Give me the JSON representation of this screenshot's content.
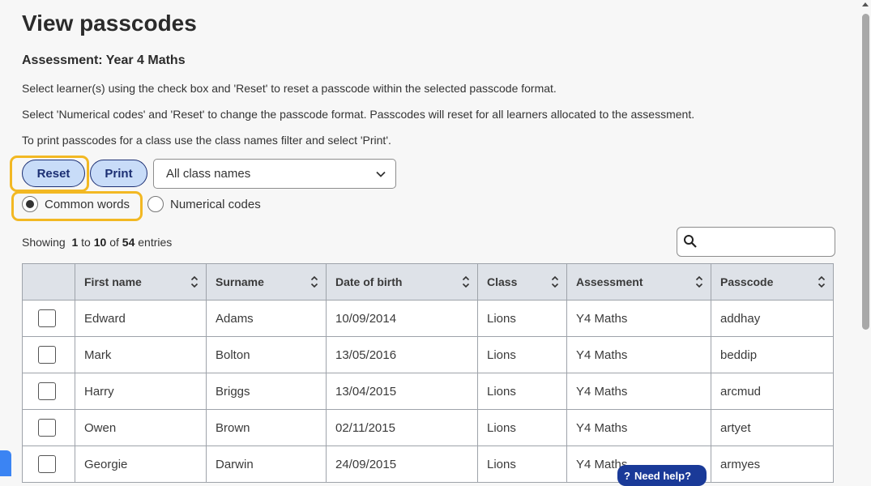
{
  "page": {
    "title": "View passcodes",
    "assessment": "Assessment: Year 4 Maths",
    "instructions": [
      "Select learner(s) using the check box and 'Reset' to reset a passcode within the selected passcode format.",
      "Select 'Numerical codes' and 'Reset' to change the passcode format. Passcodes will reset for all learners allocated to the assessment.",
      "To print passcodes for a class use the class names filter and select 'Print'."
    ]
  },
  "toolbar": {
    "reset_label": "Reset",
    "print_label": "Print",
    "class_filter": "All class names"
  },
  "format": {
    "common_words": "Common words",
    "numerical_codes": "Numerical codes",
    "selected": "common_words"
  },
  "entries": {
    "prefix": "Showing",
    "from": "1",
    "to_word": "to",
    "to": "10",
    "of_word": "of",
    "total": "54",
    "suffix": "entries"
  },
  "table": {
    "headers": [
      "First name",
      "Surname",
      "Date of birth",
      "Class",
      "Assessment",
      "Passcode"
    ],
    "rows": [
      [
        "Edward",
        "Adams",
        "10/09/2014",
        "Lions",
        "Y4 Maths",
        "addhay"
      ],
      [
        "Mark",
        "Bolton",
        "13/05/2016",
        "Lions",
        "Y4 Maths",
        "beddip"
      ],
      [
        "Harry",
        "Briggs",
        "13/04/2015",
        "Lions",
        "Y4 Maths",
        "arcmud"
      ],
      [
        "Owen",
        "Brown",
        "02/11/2015",
        "Lions",
        "Y4 Maths",
        "artyet"
      ],
      [
        "Georgie",
        "Darwin",
        "24/09/2015",
        "Lions",
        "Y4 Maths",
        "armyes"
      ]
    ]
  },
  "help": {
    "label": "Need help?",
    "icon": "help-circle-icon"
  },
  "colors": {
    "highlight": "#f2b823",
    "button_bg": "#c8dcf8",
    "button_border": "#1c2f73",
    "header_bg": "#dee2e8"
  }
}
